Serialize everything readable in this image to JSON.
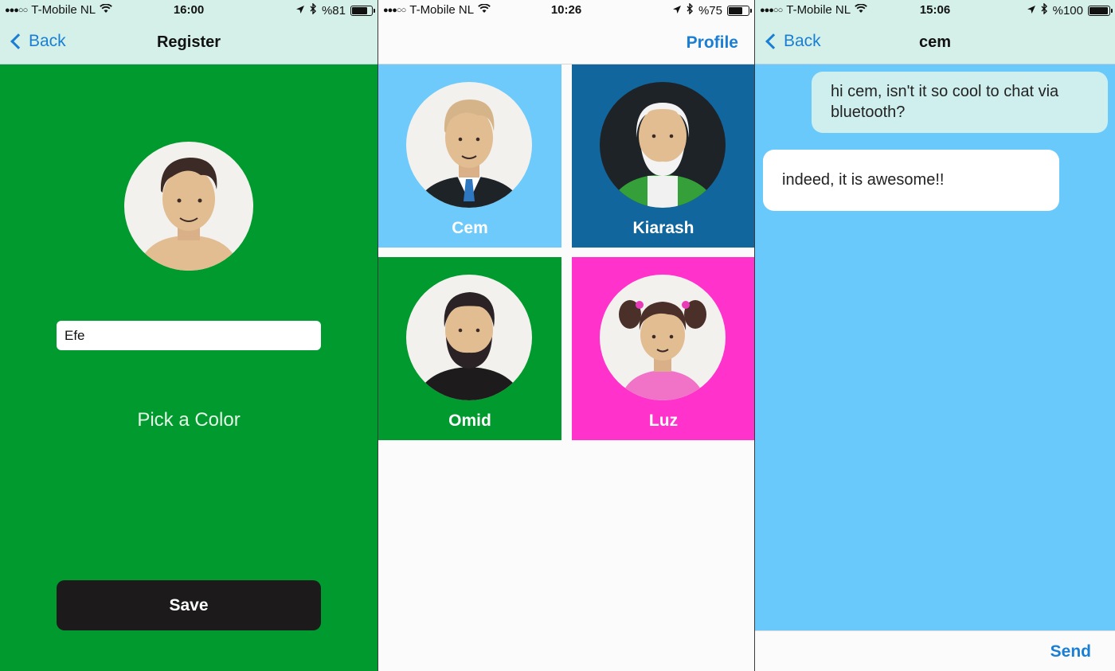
{
  "register": {
    "status": {
      "carrier": "T-Mobile NL",
      "time": "16:00",
      "battery": "%81",
      "battery_level": 81
    },
    "nav": {
      "back": "Back",
      "title": "Register"
    },
    "name_value": "Efe",
    "pick_color": "Pick a Color",
    "save": "Save",
    "bg_color": "#009a2e"
  },
  "contacts": {
    "status": {
      "carrier": "T-Mobile NL",
      "time": "10:26",
      "battery": "%75",
      "battery_level": 75
    },
    "nav": {
      "profile": "Profile"
    },
    "tiles": [
      {
        "name": "Cem",
        "color": "#6dcafb"
      },
      {
        "name": "Kiarash",
        "color": "#11669e"
      },
      {
        "name": "Omid",
        "color": "#009a2e"
      },
      {
        "name": "Luz",
        "color": "#ff33cc"
      }
    ]
  },
  "chat": {
    "status": {
      "carrier": "T-Mobile NL",
      "time": "15:06",
      "battery": "%100",
      "battery_level": 100
    },
    "nav": {
      "back": "Back",
      "title": "cem"
    },
    "messages": [
      {
        "direction": "out",
        "text": "hi cem, isn't it so cool to chat via bluetooth?"
      },
      {
        "direction": "in",
        "text": "indeed, it is awesome!!"
      }
    ],
    "send": "Send",
    "bg_color": "#69c9fb"
  }
}
